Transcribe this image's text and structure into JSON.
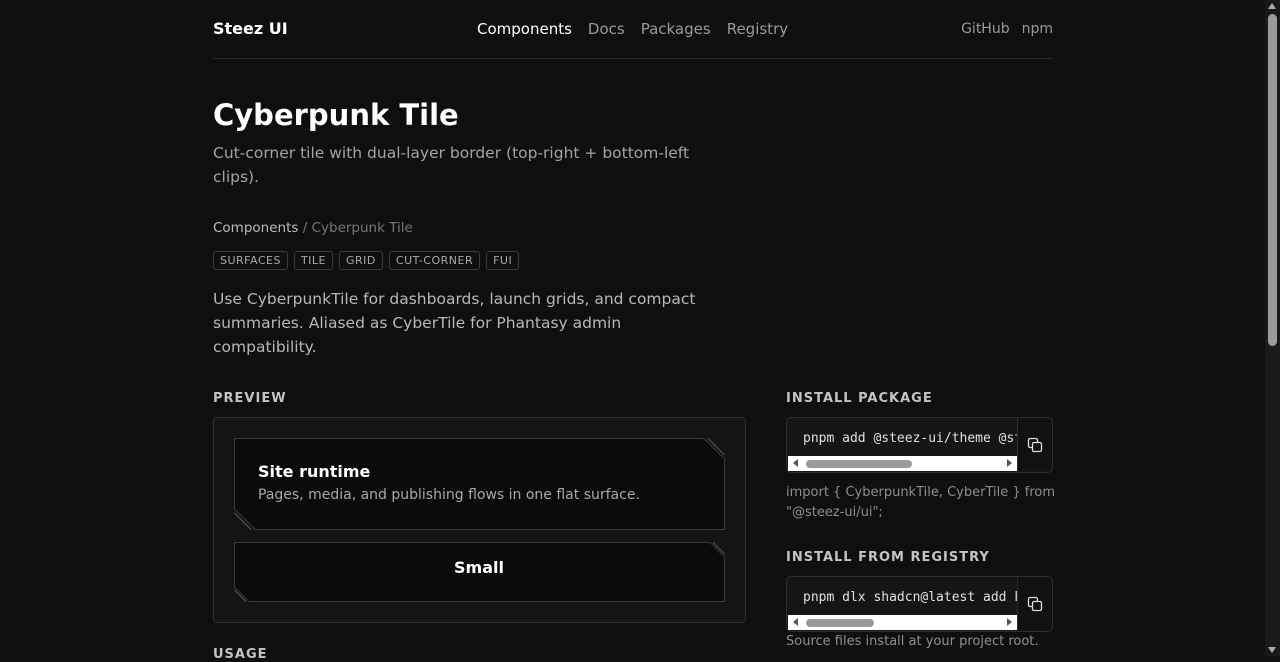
{
  "header": {
    "brand": "Steez UI",
    "nav": [
      "Components",
      "Docs",
      "Packages",
      "Registry"
    ],
    "active_nav": "Components",
    "right_links": [
      "GitHub",
      "npm"
    ]
  },
  "page": {
    "title": "Cyberpunk Tile",
    "subtitle": "Cut-corner tile with dual-layer border (top-right + bottom-left clips).",
    "breadcrumb": {
      "parent": "Components",
      "separator": "/",
      "current": "Cyberpunk Tile"
    },
    "tags": [
      "SURFACES",
      "TILE",
      "GRID",
      "CUT-CORNER",
      "FUI"
    ],
    "description": "Use CyberpunkTile for dashboards, launch grids, and compact summaries. Aliased as CyberTile for Phantasy admin compatibility."
  },
  "preview": {
    "heading": "PREVIEW",
    "tile_primary": {
      "title": "Site runtime",
      "text": "Pages, media, and publishing flows in one flat surface."
    },
    "tile_small": {
      "title": "Small"
    }
  },
  "install_package": {
    "heading": "INSTALL PACKAGE",
    "command": "pnpm add @steez-ui/theme @steez-ui/ui",
    "import_note": "import { CyberpunkTile, CyberTile } from \"@steez-ui/ui\";"
  },
  "install_registry": {
    "heading": "INSTALL FROM REGISTRY",
    "command": "pnpm dlx shadcn@latest add https://steez-ui.dev/r/cyberpunk-tile.json",
    "note": "Source files install at your project root."
  },
  "usage": {
    "heading": "USAGE"
  },
  "icons": {
    "copy": "copy-icon"
  }
}
